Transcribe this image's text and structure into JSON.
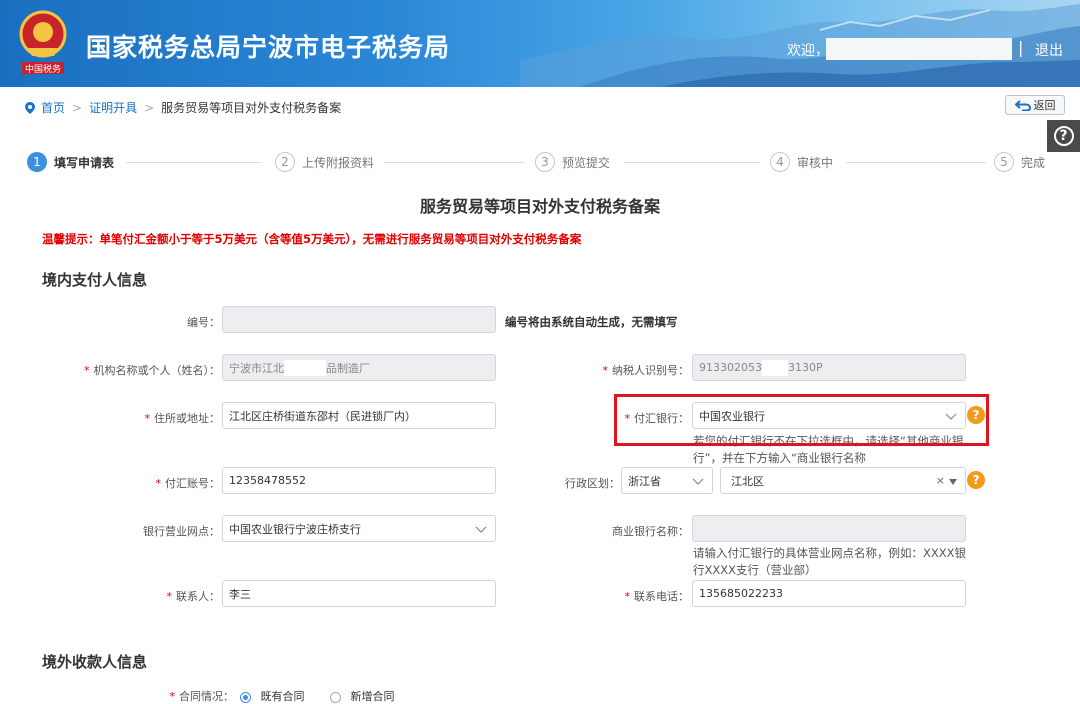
{
  "header": {
    "title": "国家税务总局宁波市电子税务局",
    "welcome": "欢迎，",
    "separator": "|",
    "logout": "退出"
  },
  "breadcrumb": {
    "home": "首页",
    "cert": "证明开具",
    "current": "服务贸易等项目对外支付税务备案",
    "sep": ">"
  },
  "back_label": "返回",
  "help_label": "?",
  "steps": [
    {
      "num": "1",
      "label": "填写申请表"
    },
    {
      "num": "2",
      "label": "上传附报资料"
    },
    {
      "num": "3",
      "label": "预览提交"
    },
    {
      "num": "4",
      "label": "审核中"
    },
    {
      "num": "5",
      "label": "完成"
    }
  ],
  "form_title": "服务贸易等项目对外支付税务备案",
  "tip": "温馨提示：单笔付汇金额小于等于5万美元（含等值5万美元），无需进行服务贸易等项目对外支付税务备案",
  "section_domestic": "境内支付人信息",
  "section_foreign": "境外收款人信息",
  "fields": {
    "id_label": "编号：",
    "id_note": "编号将由系统自动生成，无需填写",
    "org_label": "机构名称或个人（姓名）：",
    "org_value_a": "宁波市江北",
    "org_value_b": "品制造厂",
    "taxid_label": "纳税人识别号：",
    "taxid_value_a": "913302053",
    "taxid_value_b": "3130P",
    "address_label": "住所或地址：",
    "address_value": "江北区庄桥街道东邵村（民进锁厂内）",
    "bank_label": "付汇银行：",
    "bank_value": "中国农业银行",
    "bank_hint": "若您的付汇银行不在下拉选框中，请选择“其他商业银行”，并在下方输入“商业银行名称",
    "account_label": "付汇账号：",
    "account_value": "12358478552",
    "region_label": "行政区划：",
    "province_value": "浙江省",
    "district_value": "江北区",
    "clear_mark": "×",
    "branch_label": "银行营业网点：",
    "branch_value": "中国农业银行宁波庄桥支行",
    "commbank_label": "商业银行名称：",
    "commbank_hint": "请输入付汇银行的具体营业网点名称，例如：XXXX银行XXXX支行（营业部）",
    "contact_label": "联系人：",
    "contact_value": "李三",
    "phone_label": "联系电话：",
    "phone_value": "135685022233",
    "contract_label": "合同情况：",
    "contract_opt1": "既有合同",
    "contract_opt2": "新增合同",
    "required_mark": "*"
  }
}
